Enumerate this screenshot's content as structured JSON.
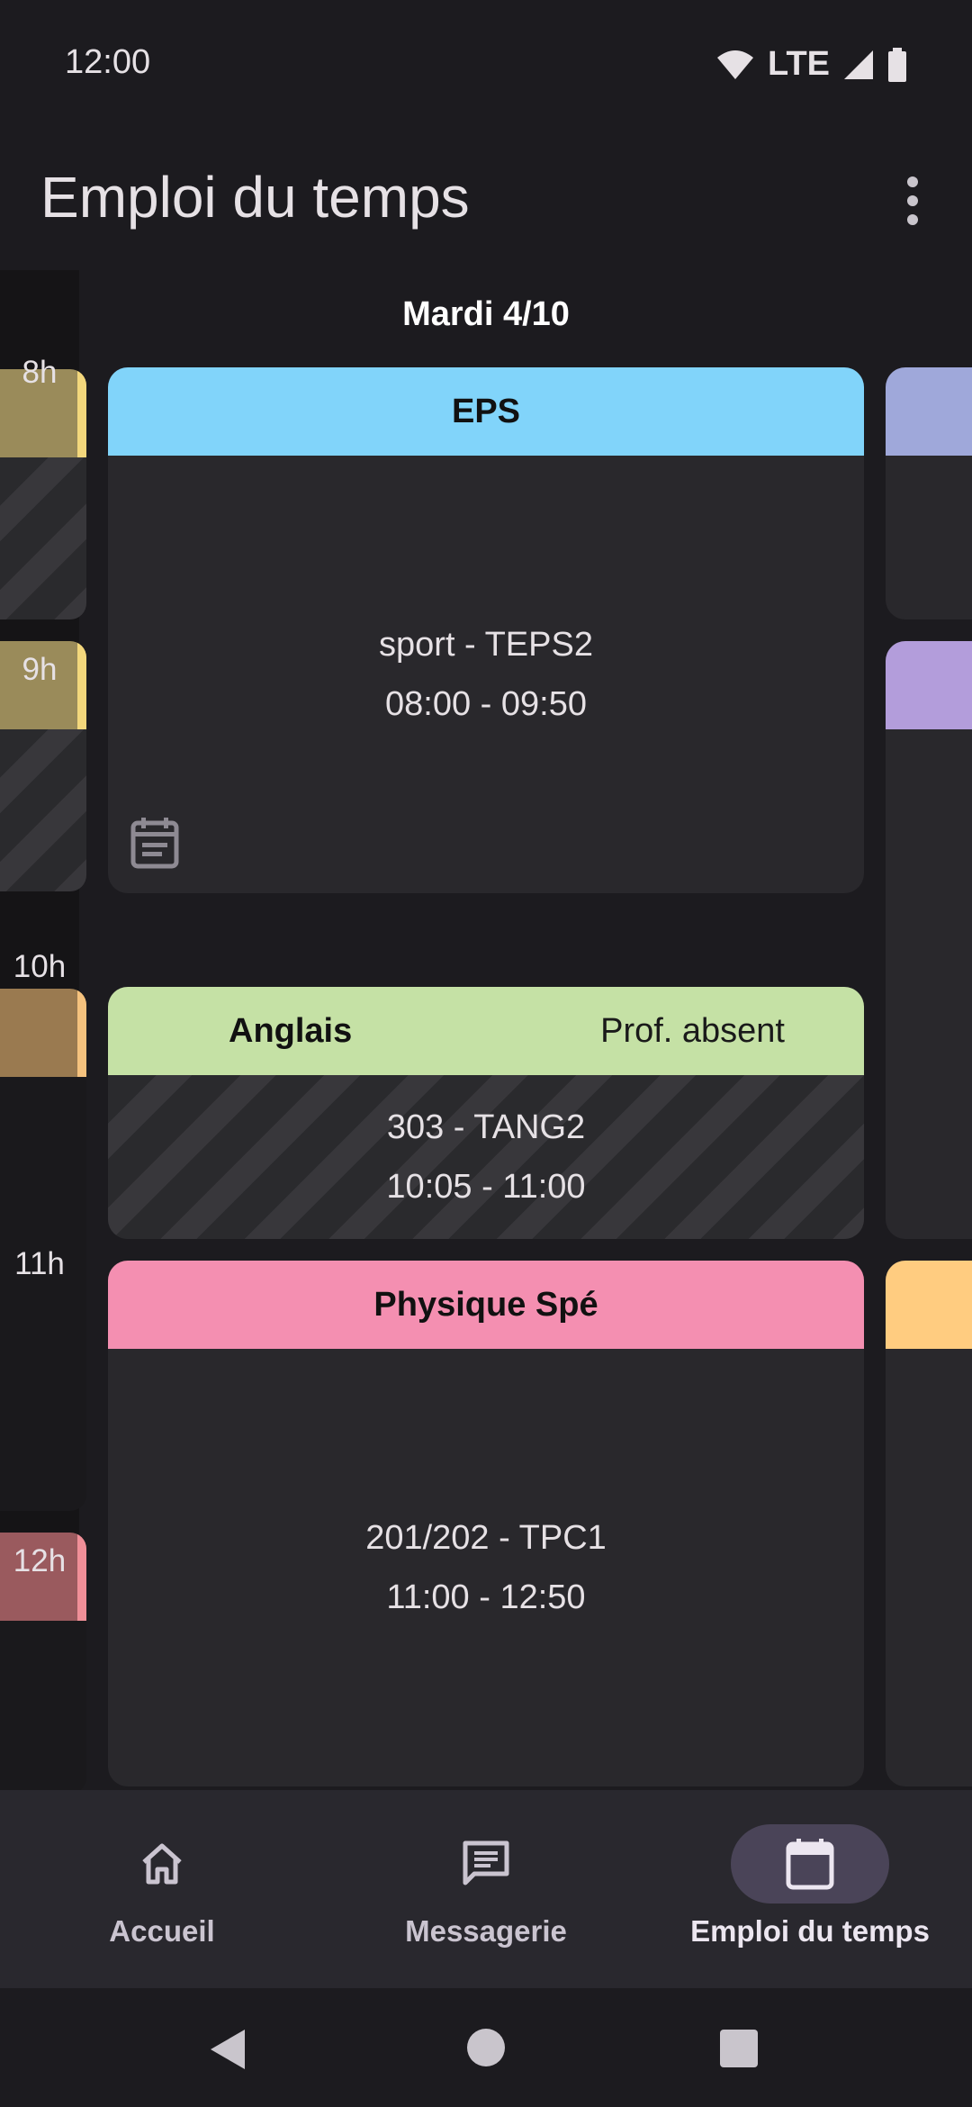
{
  "status_bar": {
    "time": "12:00",
    "network": "LTE"
  },
  "app_bar": {
    "title": "Emploi du temps"
  },
  "schedule": {
    "day_title": "Mardi 4/10",
    "hours": [
      "8h",
      "9h",
      "10h",
      "11h",
      "12h"
    ],
    "courses": [
      {
        "subject": "EPS",
        "status": "",
        "room": "sport - TEPS2",
        "time": "08:00 - 09:50",
        "color": "#81d4fa"
      },
      {
        "subject": "Anglais",
        "status": "Prof. absent",
        "room": "303 - TANG2",
        "time": "10:05 - 11:00",
        "color": "#c5e1a5"
      },
      {
        "subject": "Physique Spé",
        "status": "",
        "room": "201/202 - TPC1",
        "time": "11:00 - 12:50",
        "color": "#f48fb1"
      }
    ]
  },
  "colors": {
    "background": "#1c1b1f",
    "card": "#29282c",
    "nav_bar": "#29282e",
    "nav_active_pill": "#4a4458"
  },
  "bottom_nav": {
    "items": [
      {
        "label": "Accueil",
        "icon": "home-icon"
      },
      {
        "label": "Messagerie",
        "icon": "message-icon"
      },
      {
        "label": "Emploi du temps",
        "icon": "calendar-icon",
        "active": true
      }
    ]
  },
  "system_nav": {
    "icons": [
      "back-icon",
      "home-circle-icon",
      "recents-icon"
    ]
  }
}
